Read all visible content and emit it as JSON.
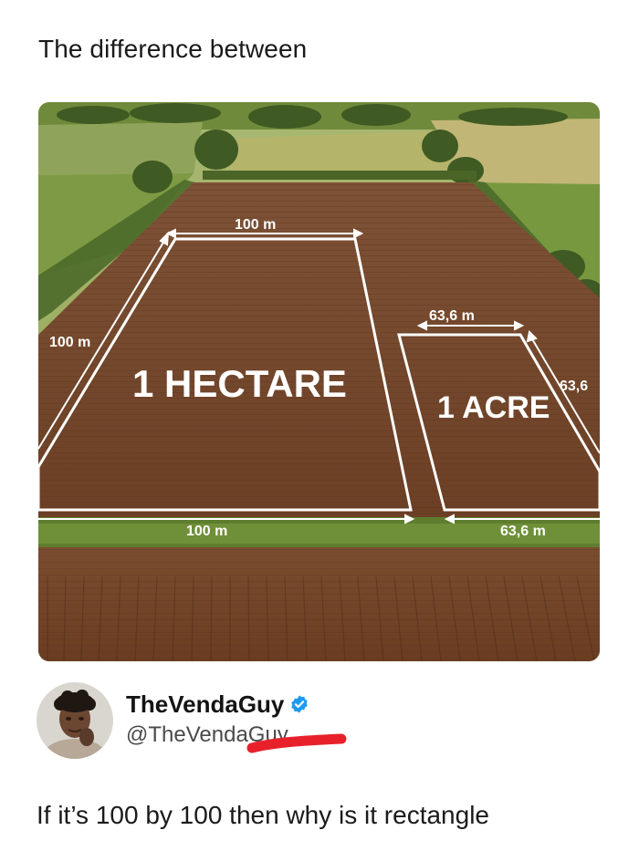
{
  "post": {
    "caption": "The difference between"
  },
  "image": {
    "hectare_label": "1 HECTARE",
    "acre_label": "1 ACRE",
    "dimensions": {
      "hectare_top": "100 m",
      "hectare_left": "100 m",
      "hectare_bottom": "100 m",
      "acre_top": "63,6 m",
      "acre_right": "63,6",
      "acre_bottom": "63,6 m"
    }
  },
  "author": {
    "display_name": "TheVendaGuy",
    "handle": "@TheVendaGuy",
    "verified": true,
    "verified_color": "#1d9bf0",
    "avatar_icon": "avatar-photo"
  },
  "tweet": {
    "text": "If it’s 100 by 100 then why is it rectangle"
  },
  "colors": {
    "soil": "#7a4a2c",
    "grass": "#6d8a3a",
    "line": "#ffffff",
    "redaction": "#e8202a"
  }
}
